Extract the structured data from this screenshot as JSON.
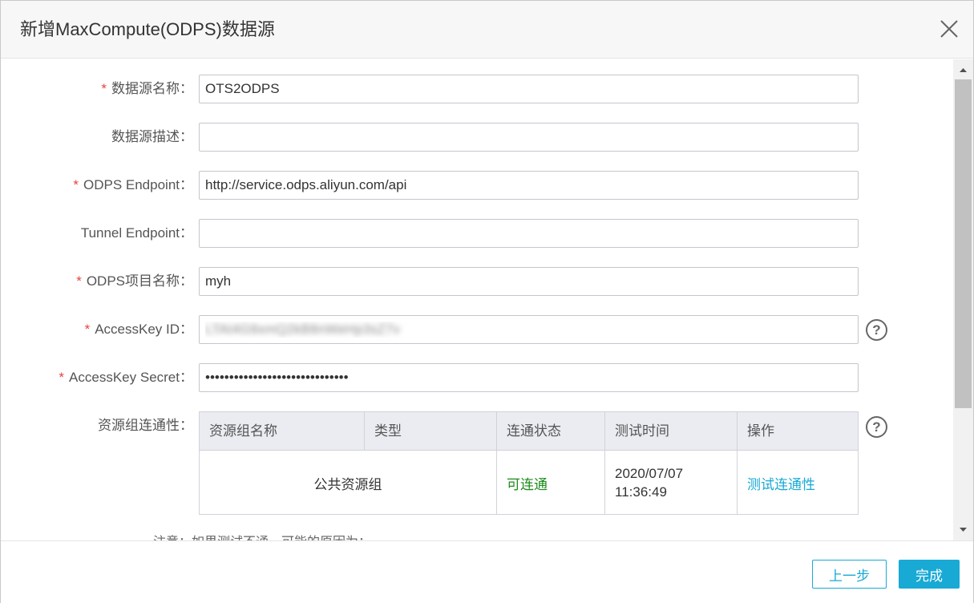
{
  "dialog": {
    "title": "新增MaxCompute(ODPS)数据源"
  },
  "form": {
    "required_mark": "*",
    "fields": [
      {
        "label": "数据源名称：",
        "required": true,
        "value": "OTS2ODPS"
      },
      {
        "label": "数据源描述：",
        "required": false,
        "value": ""
      },
      {
        "label": "ODPS Endpoint：",
        "required": true,
        "value": "http://service.odps.aliyun.com/api"
      },
      {
        "label": "Tunnel Endpoint：",
        "required": false,
        "value": ""
      },
      {
        "label": "ODPS项目名称：",
        "required": true,
        "value": "myh"
      },
      {
        "label": "AccessKey ID：",
        "required": true,
        "value": "LTAI4G9xmQ2kB8nWeHp3sZ7v",
        "blurred": true
      },
      {
        "label": "AccessKey Secret：",
        "required": true,
        "value": "••••••••••••••••••••••••••••••"
      }
    ],
    "help_glyph": "?"
  },
  "connectivity": {
    "label": "资源组连通性：",
    "columns": [
      "资源组名称",
      "类型",
      "连通状态",
      "测试时间",
      "操作"
    ],
    "rows": [
      {
        "group": "公共资源组",
        "type": "",
        "status": "可连通",
        "test_date": "2020/07/07",
        "test_time": "11:36:49",
        "action": "测试连通性"
      }
    ]
  },
  "note": "注意：如果测试不通，可能的原因为：",
  "footer": {
    "prev_label": "上一步",
    "done_label": "完成"
  },
  "colors": {
    "accent": "#19a9d5",
    "required": "#e64340",
    "success": "#1d8b1b"
  }
}
